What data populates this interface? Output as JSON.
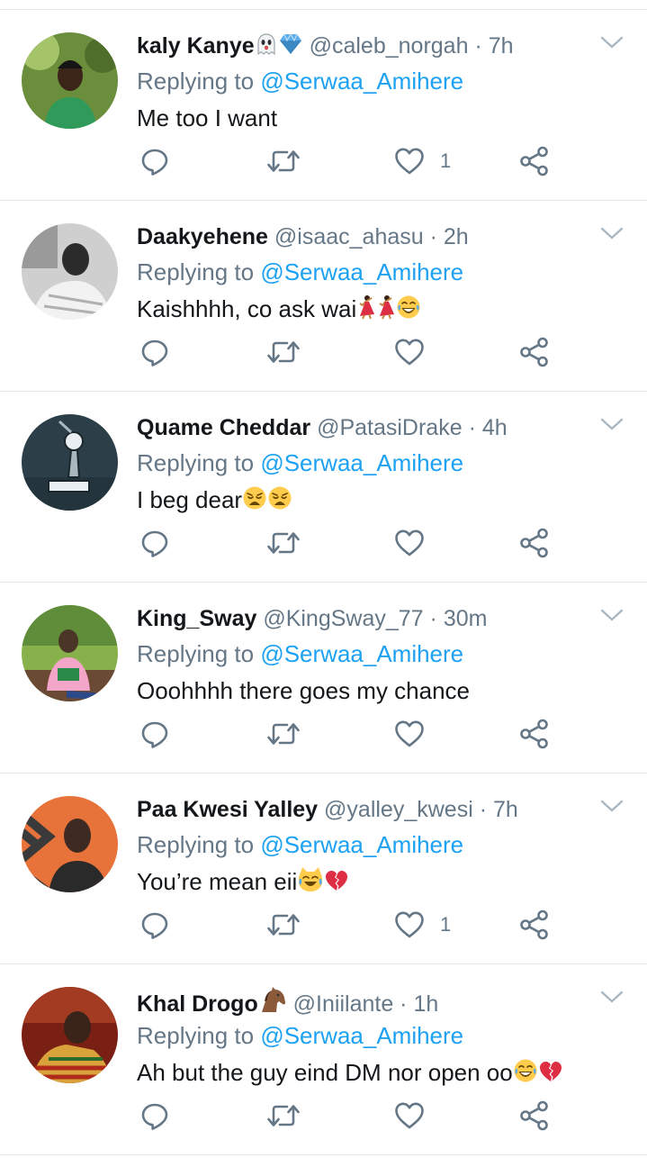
{
  "tweets": [
    {
      "name": "kaly Kanye",
      "name_emoji": "ghost diamond",
      "handle": "@caleb_norgah",
      "time": "7h",
      "replying_prefix": "Replying to",
      "replying_to": "@Serwaa_Amihere",
      "text": "Me too I want",
      "text_emoji": "",
      "likes": "1",
      "avatar_colors": [
        "#6b8e3d",
        "#2f9a5a",
        "#3b2418"
      ]
    },
    {
      "name": "Daakyehene",
      "name_emoji": "",
      "handle": "@isaac_ahasu",
      "time": "2h",
      "replying_prefix": "Replying to",
      "replying_to": "@Serwaa_Amihere",
      "text": "Kaishhhh, co ask wai",
      "text_emoji": "dancer dancer laugh",
      "likes": "",
      "avatar_colors": [
        "#cfcfcf",
        "#f2f2f2",
        "#2b2b2b"
      ]
    },
    {
      "name": "Quame Cheddar",
      "name_emoji": "",
      "handle": "@PatasiDrake",
      "time": "4h",
      "replying_prefix": "Replying to",
      "replying_to": "@Serwaa_Amihere",
      "text": "I beg dear",
      "text_emoji": "weary weary",
      "likes": "",
      "avatar_colors": [
        "#2c3e48",
        "#a9b7bf",
        "#e8eef1"
      ]
    },
    {
      "name": "King_Sway",
      "name_emoji": "",
      "handle": "@KingSway_77",
      "time": "30m",
      "replying_prefix": "Replying to",
      "replying_to": "@Serwaa_Amihere",
      "text": "Ooohhhh there goes my chance",
      "text_emoji": "",
      "likes": "",
      "avatar_colors": [
        "#88b04b",
        "#f3a6c8",
        "#4a3526"
      ]
    },
    {
      "name": "Paa Kwesi Yalley",
      "name_emoji": "",
      "handle": "@yalley_kwesi",
      "time": "7h",
      "replying_prefix": "Replying to",
      "replying_to": "@Serwaa_Amihere",
      "text": "You’re mean eii",
      "text_emoji": "crying-cat broken-heart",
      "likes": "1",
      "avatar_colors": [
        "#e8733a",
        "#2a2a2a",
        "#3d2a22"
      ]
    },
    {
      "name": "Khal Drogo",
      "name_emoji": "horse",
      "handle": "@Iniilante",
      "time": "1h",
      "replying_prefix": "Replying to",
      "replying_to": "@Serwaa_Amihere",
      "text": "Ah but the guy eind  DM nor open oo",
      "text_emoji": "laugh broken-heart",
      "likes": "",
      "avatar_colors": [
        "#7a1f14",
        "#d9a23a",
        "#3a2318"
      ]
    }
  ],
  "colors": {
    "mention": "#1da1f2",
    "secondary_text": "#657786",
    "divider": "#e1e8ed",
    "icon": "#657786"
  },
  "icons": [
    "reply-icon",
    "retweet-icon",
    "like-icon",
    "share-icon",
    "caret-down-icon"
  ]
}
